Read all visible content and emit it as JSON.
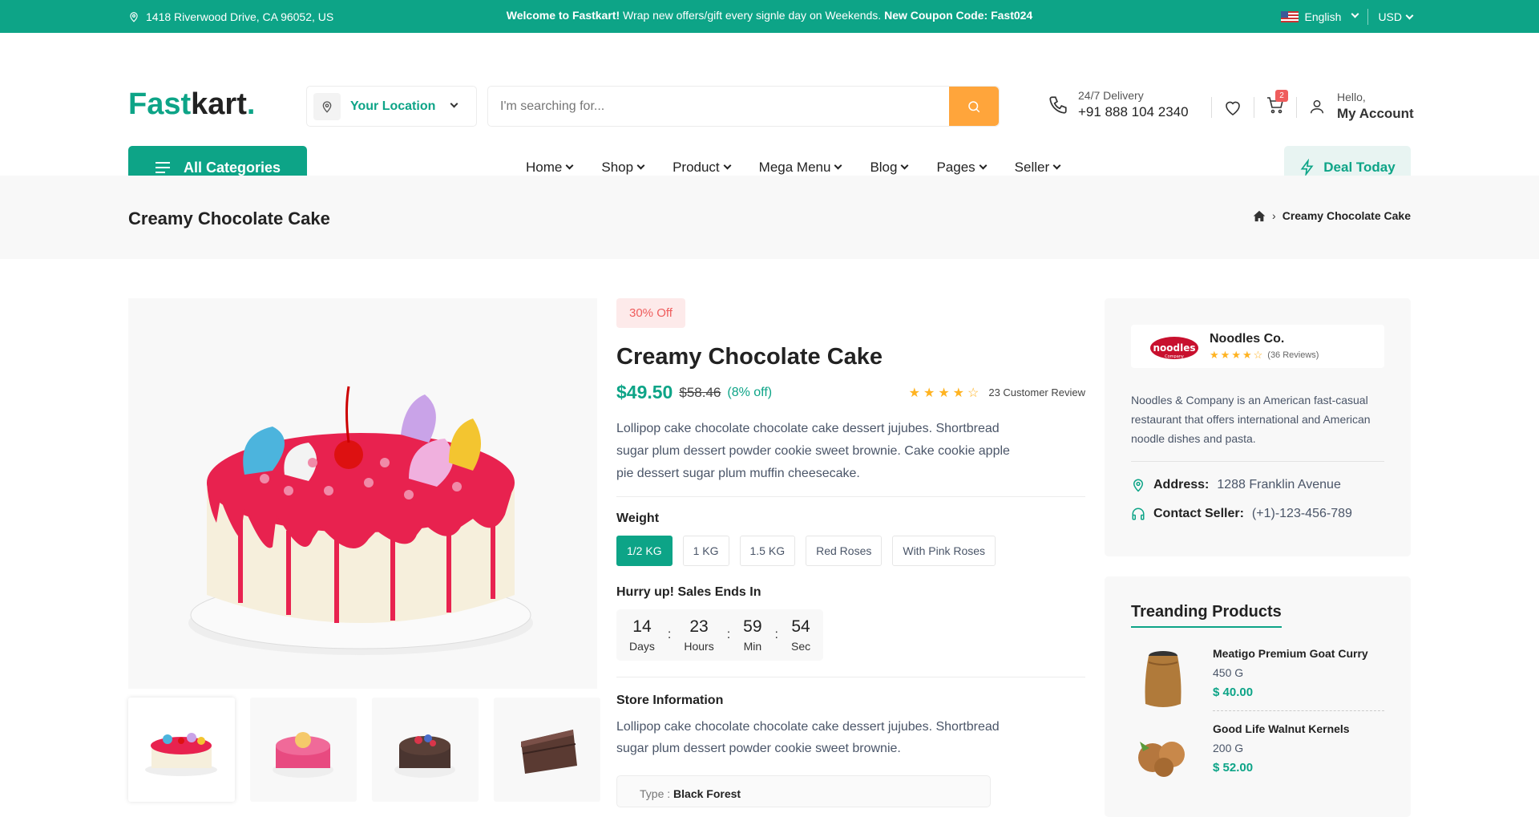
{
  "topbar": {
    "address": "1418 Riverwood Drive, CA 96052, US",
    "welcome_bold": "Welcome to Fastkart!",
    "welcome_text": " Wrap new offers/gift every signle day on Weekends. ",
    "coupon": "New Coupon Code: Fast024",
    "language": "English",
    "currency": "USD"
  },
  "header": {
    "logo_main": "Fast",
    "logo_accent": "kart",
    "logo_dot": ".",
    "location_label": "Your Location",
    "search_placeholder": "I'm searching for...",
    "delivery_label": "24/7 Delivery",
    "delivery_phone": "+91 888 104 2340",
    "cart_count": "2",
    "hello": "Hello,",
    "account": "My Account"
  },
  "nav": {
    "categories": "All Categories",
    "items": [
      "Home",
      "Shop",
      "Product",
      "Mega Menu",
      "Blog",
      "Pages",
      "Seller"
    ],
    "deal": "Deal Today"
  },
  "breadcrumb": {
    "title": "Creamy Chocolate Cake",
    "current": "Creamy Chocolate Cake"
  },
  "product": {
    "discount_badge": "30% Off",
    "name": "Creamy Chocolate Cake",
    "price": "$49.50",
    "old_price": "$58.46",
    "off_text": "(8% off)",
    "rating": 4,
    "review_text": "23 Customer Review",
    "description": "Lollipop cake chocolate chocolate cake dessert jujubes. Shortbread sugar plum dessert powder cookie sweet brownie. Cake cookie apple pie dessert sugar plum muffin cheesecake.",
    "weight_label": "Weight",
    "weights": [
      "1/2 KG",
      "1 KG",
      "1.5 KG",
      "Red Roses",
      "With Pink Roses"
    ],
    "selected_weight": "1/2 KG",
    "hurry_label": "Hurry up! Sales Ends In",
    "timer": {
      "days": "14",
      "days_label": "Days",
      "hours": "23",
      "hours_label": "Hours",
      "min": "59",
      "min_label": "Min",
      "sec": "54",
      "sec_label": "Sec"
    },
    "store_info_label": "Store Information",
    "store_info": "Lollipop cake chocolate chocolate cake dessert jujubes. Shortbread sugar plum dessert powder cookie sweet brownie.",
    "type_label": "Type : ",
    "type_value": "Black Forest"
  },
  "seller": {
    "name": "Noodles Co.",
    "rating": 4,
    "reviews": "(36 Reviews)",
    "description": "Noodles & Company is an American fast-casual restaurant that offers international and American noodle dishes and pasta.",
    "address_label": "Address:",
    "address": "1288 Franklin Avenue",
    "contact_label": "Contact Seller:",
    "contact": "(+1)-123-456-789",
    "logo_text": "noodles",
    "logo_sub": "Company"
  },
  "trending": {
    "title": "Treanding Products",
    "items": [
      {
        "name": "Meatigo Premium Goat Curry",
        "weight": "450 G",
        "price": "$ 40.00"
      },
      {
        "name": "Good Life Walnut Kernels",
        "weight": "200 G",
        "price": "$ 52.00"
      }
    ]
  },
  "colors": {
    "brand": "#0da487",
    "accent": "#ffa53b",
    "danger": "#ef5d5d"
  }
}
